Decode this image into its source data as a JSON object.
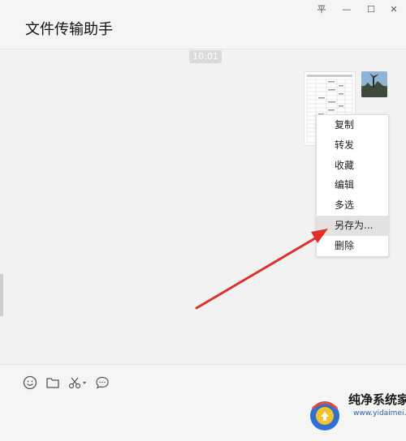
{
  "header": {
    "title": "文件传输助手",
    "window_controls": {
      "pin": "平",
      "minimize": "—",
      "maximize": "☐",
      "close": "✕"
    }
  },
  "chat": {
    "timestamp": "10:01",
    "message": {
      "type": "file-thumbnail",
      "icon": "spreadsheet-document-icon"
    }
  },
  "context_menu": {
    "items": [
      "复制",
      "转发",
      "收藏",
      "编辑",
      "多选",
      "另存为...",
      "删除"
    ],
    "highlighted": "另存为..."
  },
  "toolbar": {
    "icons": [
      "emoji-icon",
      "folder-icon",
      "scissors-icon",
      "chat-bubble-icon"
    ]
  },
  "watermark": {
    "text": "纯净系统家园",
    "url": "www.yidaimei.com"
  },
  "colors": {
    "accent_arrow": "#e0302a",
    "menu_hover": "#e2e2e2"
  }
}
